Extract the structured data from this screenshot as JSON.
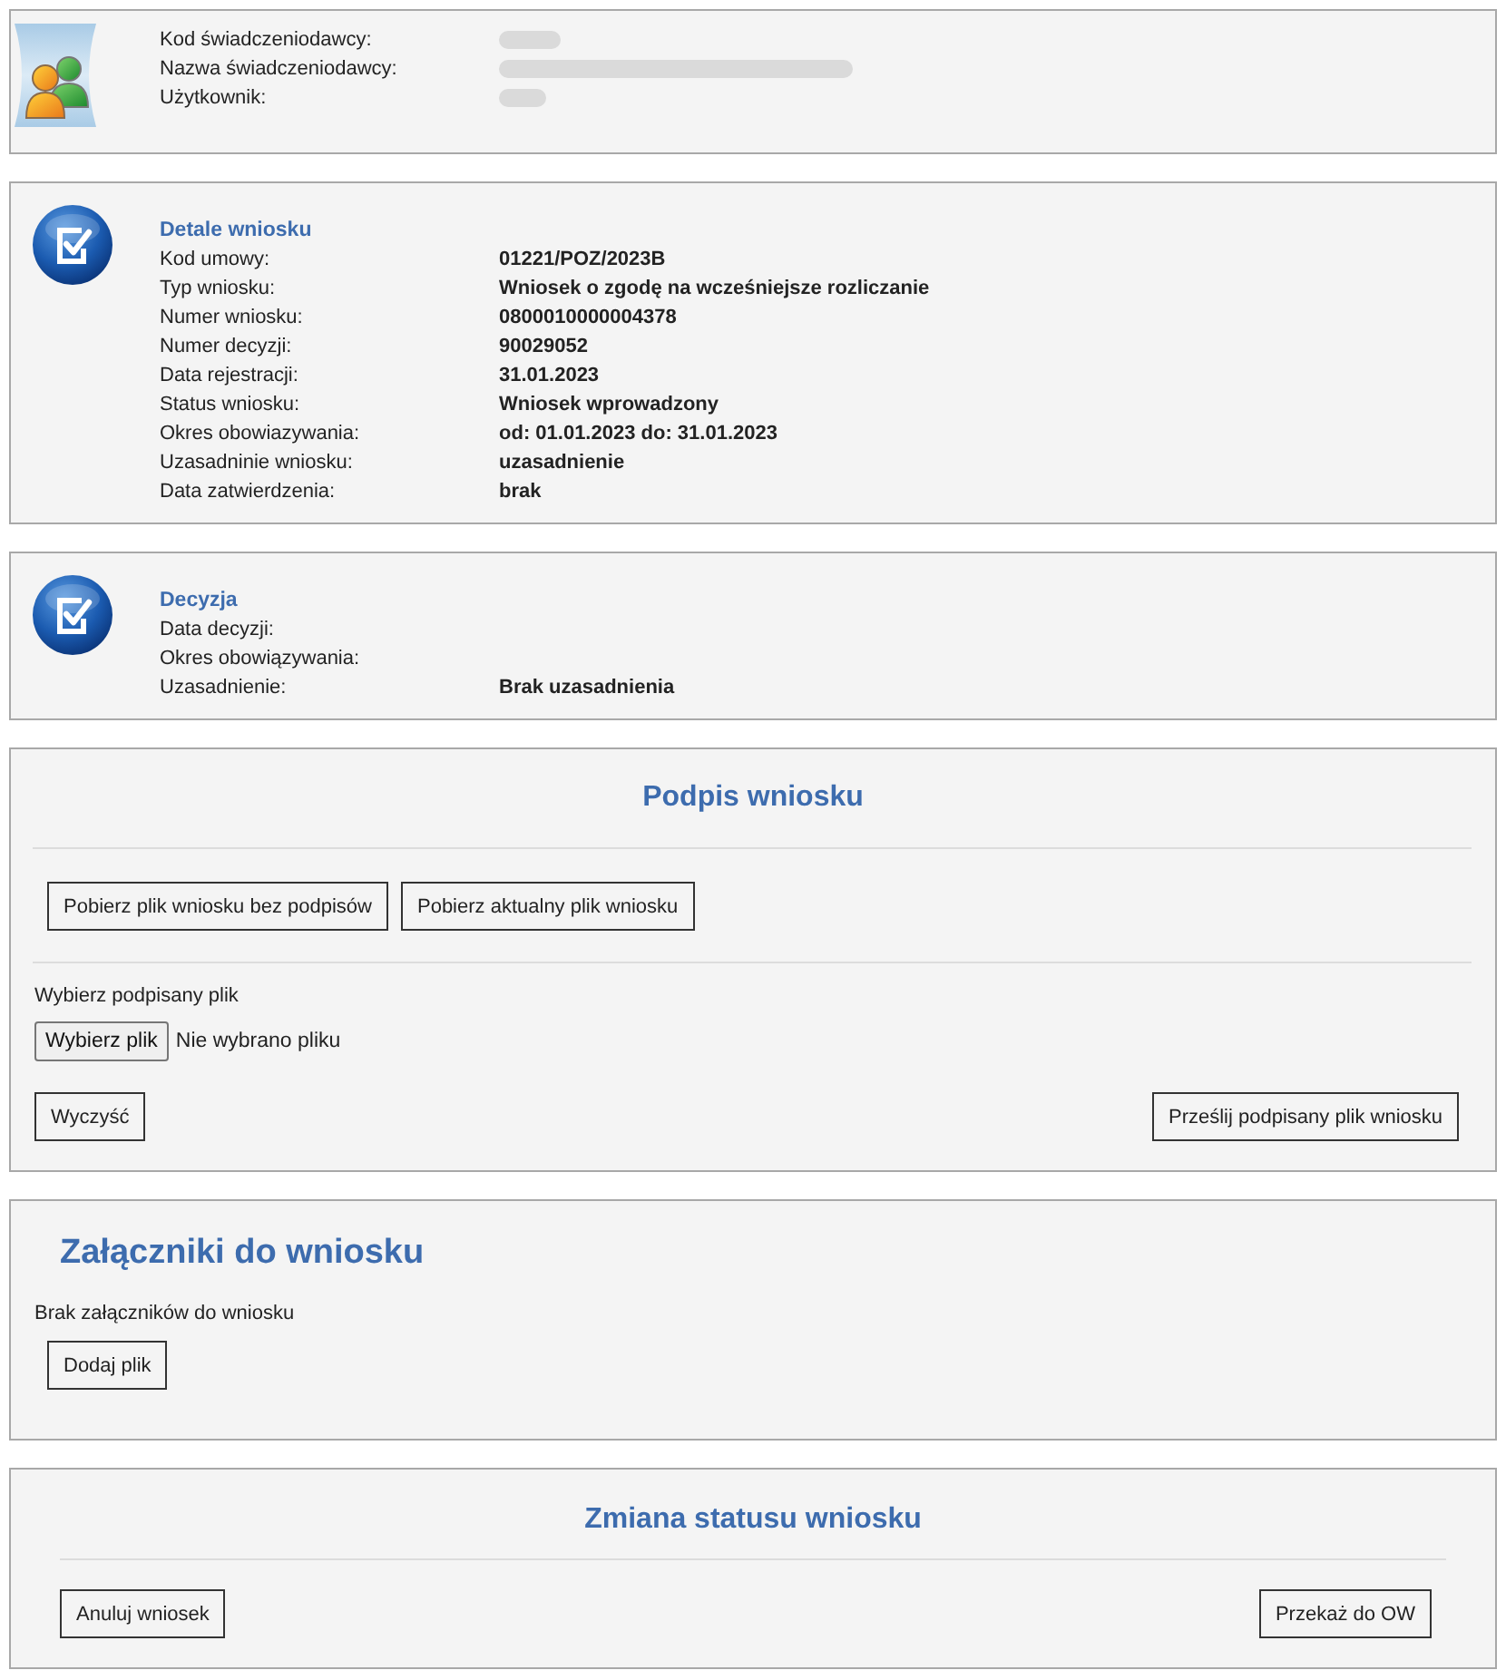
{
  "header": {
    "fields": [
      {
        "label": "Kod świadczeniodawcy:",
        "redacted": true
      },
      {
        "label": "Nazwa świadczeniodawcy:",
        "redacted": true
      },
      {
        "label": "Użytkownik:",
        "redacted": true
      }
    ]
  },
  "details": {
    "title": "Detale wniosku",
    "fields": [
      {
        "label": "Kod umowy:",
        "value": "01221/POZ/2023B"
      },
      {
        "label": "Typ wniosku:",
        "value": "Wniosek o zgodę na wcześniejsze rozliczanie"
      },
      {
        "label": "Numer wniosku:",
        "value": "0800010000004378"
      },
      {
        "label": "Numer decyzji:",
        "value": "90029052"
      },
      {
        "label": "Data rejestracji:",
        "value": "31.01.2023"
      },
      {
        "label": "Status wniosku:",
        "value": "Wniosek wprowadzony"
      },
      {
        "label": "Okres obowiazywania:",
        "value": "od: 01.01.2023 do: 31.01.2023"
      },
      {
        "label": "Uzasadninie wniosku:",
        "value": "uzasadnienie"
      },
      {
        "label": "Data zatwierdzenia:",
        "value": "brak"
      }
    ]
  },
  "decision": {
    "title": "Decyzja",
    "fields": [
      {
        "label": "Data decyzji:"
      },
      {
        "label": "Okres obowiązywania:"
      },
      {
        "label": "Uzasadnienie:",
        "value": "Brak uzasadnienia"
      }
    ]
  },
  "signature": {
    "title": "Podpis wniosku",
    "download_buttons": [
      "Pobierz plik wniosku bez podpisów",
      "Pobierz aktualny plik wniosku"
    ],
    "file_label": "Wybierz podpisany plik",
    "file_button": "Wybierz plik",
    "file_status": "Nie wybrano pliku",
    "clear_button": "Wyczyść",
    "submit_button": "Prześlij podpisany plik wniosku"
  },
  "attachments": {
    "title": "Załączniki do wniosku",
    "empty_text": "Brak załączników do wniosku",
    "add_button": "Dodaj plik"
  },
  "status_change": {
    "title": "Zmiana statusu wniosku",
    "cancel_button": "Anuluj wniosek",
    "forward_button": "Przekaż do OW"
  }
}
